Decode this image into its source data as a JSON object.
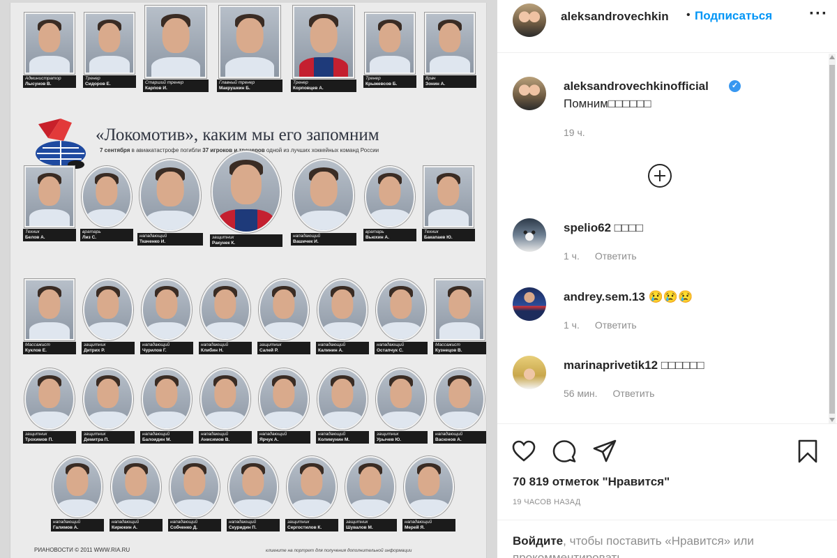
{
  "poster": {
    "title": "«Локомотив», каким мы его запомним",
    "subtitle_parts": [
      "7 сентября",
      " в авиакатастрофе погибли ",
      "37 игроков и тренеров",
      " одной из лучших хоккейных команд России"
    ],
    "footer": "РИАНОВОСТИ © 2011 WWW.RIA.RU",
    "note": "кликните на портрет для получения дополнительной информации",
    "rows": [
      [
        {
          "role": "Администратор",
          "name": "Лысунов В."
        },
        {
          "role": "Тренер",
          "name": "Сидоров Е."
        },
        {
          "role": "Старший тренер",
          "name": "Карпов И."
        },
        {
          "role": "Главный тренер",
          "name": "Макрушкин Б."
        },
        {
          "role": "Тренер",
          "name": "Корповцев А."
        },
        {
          "role": "Тренер",
          "name": "Крыжевсов Б."
        },
        {
          "role": "Врач",
          "name": "Зонин А."
        }
      ],
      [
        {
          "role": "Техник",
          "name": "Белов А."
        },
        {
          "role": "вратарь",
          "name": "Лиз С."
        },
        {
          "role": "нападающий",
          "name": "Ткаченко И."
        },
        {
          "role": "защитник",
          "name": "Ракунек К."
        },
        {
          "role": "нападающий",
          "name": "Вашичек И."
        },
        {
          "role": "вратарь",
          "name": "Вьюхин А."
        },
        {
          "role": "Техник",
          "name": "Бакапаев Ю."
        }
      ],
      [
        {
          "role": "Массажист",
          "name": "Куклов Е."
        },
        {
          "role": "защитник",
          "name": "Дитрих Р."
        },
        {
          "role": "нападающий",
          "name": "Чурилов Г."
        },
        {
          "role": "нападающий",
          "name": "Клибин Н."
        },
        {
          "role": "защитник",
          "name": "Салей Р."
        },
        {
          "role": "нападающий",
          "name": "Калинин А."
        },
        {
          "role": "нападающий",
          "name": "Остапчук С."
        },
        {
          "role": "Массажист",
          "name": "Кузнецов В."
        }
      ],
      [
        {
          "role": "защитник",
          "name": "Трохимов П."
        },
        {
          "role": "защитник",
          "name": "Демитра П."
        },
        {
          "role": "нападающий",
          "name": "Балоидин М."
        },
        {
          "role": "нападающий",
          "name": "Анисимов В."
        },
        {
          "role": "нападающий",
          "name": "Ярчук А."
        },
        {
          "role": "нападающий",
          "name": "Колимунин М."
        },
        {
          "role": "защитник",
          "name": "Урычев Ю."
        },
        {
          "role": "нападающий",
          "name": "Васюнов А."
        }
      ],
      [
        {
          "role": "нападающий",
          "name": "Галимов А."
        },
        {
          "role": "нападающий",
          "name": "Кирюкин А."
        },
        {
          "role": "нападающий",
          "name": "Собченко Д."
        },
        {
          "role": "нападающий",
          "name": "Скуридин П."
        },
        {
          "role": "защитник",
          "name": "Сергостилов К."
        },
        {
          "role": "защитник",
          "name": "Шувалов М."
        },
        {
          "role": "нападающий",
          "name": "Мерей Я."
        }
      ]
    ]
  },
  "header": {
    "username": "aleksandrovechkin",
    "dot": "•",
    "follow_label": "Подписаться",
    "more_label": "···"
  },
  "caption": {
    "username": "aleksandrovechkinofficial",
    "verified_mark": "✓",
    "text": "Помним□□□□□□",
    "time": "19 ч."
  },
  "comments": [
    {
      "username": "spelio62",
      "text": "□□□□",
      "time": "1 ч.",
      "reply": "Ответить"
    },
    {
      "username": "andrey.sem.13",
      "text": "😢😢😢",
      "time": "1 ч.",
      "reply": "Ответить"
    },
    {
      "username": "marinaprivetik12",
      "text": "□□□□□□",
      "time": "56 мин.",
      "reply": "Ответить"
    }
  ],
  "likes": "70 819 отметок \"Нравится\"",
  "post_time": "19 ЧАСОВ НАЗАД",
  "login": {
    "link": "Войдите",
    "text": ", чтобы поставить «Нравится» или прокомментировать."
  },
  "colors": {
    "link": "#0095f6",
    "verified": "#3897f0",
    "caption_bg": "#1b1b1b"
  },
  "icons": [
    "heart-icon",
    "comment-icon",
    "share-icon",
    "bookmark-icon",
    "plus-circle-icon",
    "more-icon"
  ]
}
